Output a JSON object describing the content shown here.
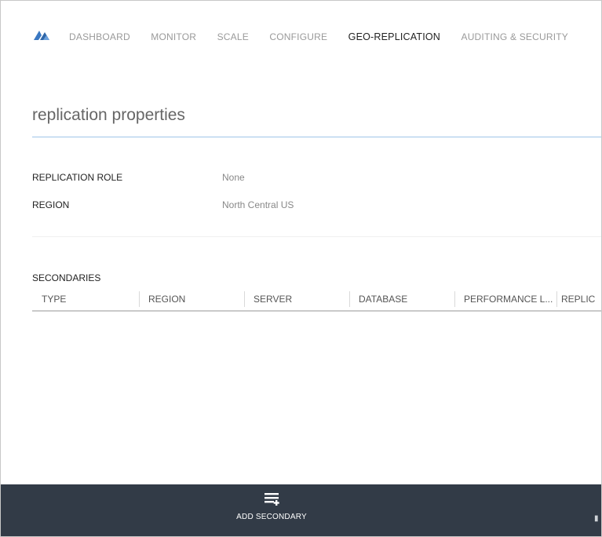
{
  "nav": {
    "items": [
      {
        "label": "DASHBOARD",
        "active": false
      },
      {
        "label": "MONITOR",
        "active": false
      },
      {
        "label": "SCALE",
        "active": false
      },
      {
        "label": "CONFIGURE",
        "active": false
      },
      {
        "label": "GEO-REPLICATION",
        "active": true
      },
      {
        "label": "AUDITING & SECURITY",
        "active": false
      }
    ]
  },
  "section": {
    "title": "replication properties"
  },
  "properties": [
    {
      "label": "REPLICATION ROLE",
      "value": "None"
    },
    {
      "label": "REGION",
      "value": "North Central US"
    }
  ],
  "secondaries": {
    "title": "SECONDARIES",
    "columns": [
      "TYPE",
      "REGION",
      "SERVER",
      "DATABASE",
      "PERFORMANCE L...",
      "REPLIC"
    ]
  },
  "command_bar": {
    "add_secondary_label": "ADD SECONDARY",
    "icon": "add-secondary-icon"
  },
  "colors": {
    "command_bar_bg": "#323b47",
    "logo_blue": "#3a78c2",
    "title_rule": "#9fc5e8"
  }
}
